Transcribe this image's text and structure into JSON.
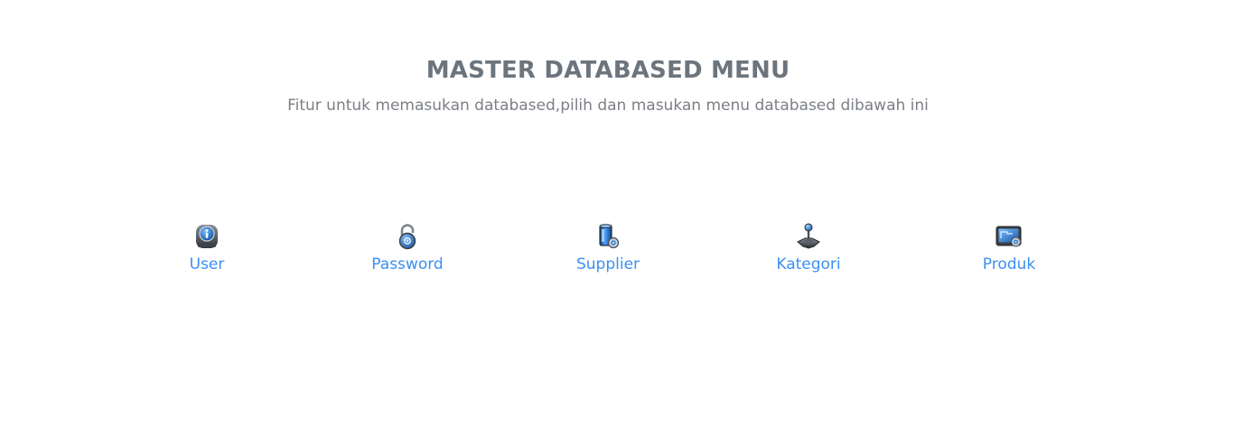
{
  "header": {
    "title": "MASTER DATABASED MENU",
    "subtitle": "Fitur untuk memasukan databased,pilih dan masukan menu databased dibawah ini"
  },
  "menu": {
    "items": [
      {
        "label": "User",
        "icon": "user-info-icon"
      },
      {
        "label": "Password",
        "icon": "padlock-icon"
      },
      {
        "label": "Supplier",
        "icon": "database-icon"
      },
      {
        "label": "Kategori",
        "icon": "joystick-icon"
      },
      {
        "label": "Produk",
        "icon": "monitor-icon"
      }
    ]
  },
  "colors": {
    "title": "#6c757d",
    "subtitle": "#7b7f85",
    "link": "#3b8ff3",
    "background": "#ffffff"
  }
}
